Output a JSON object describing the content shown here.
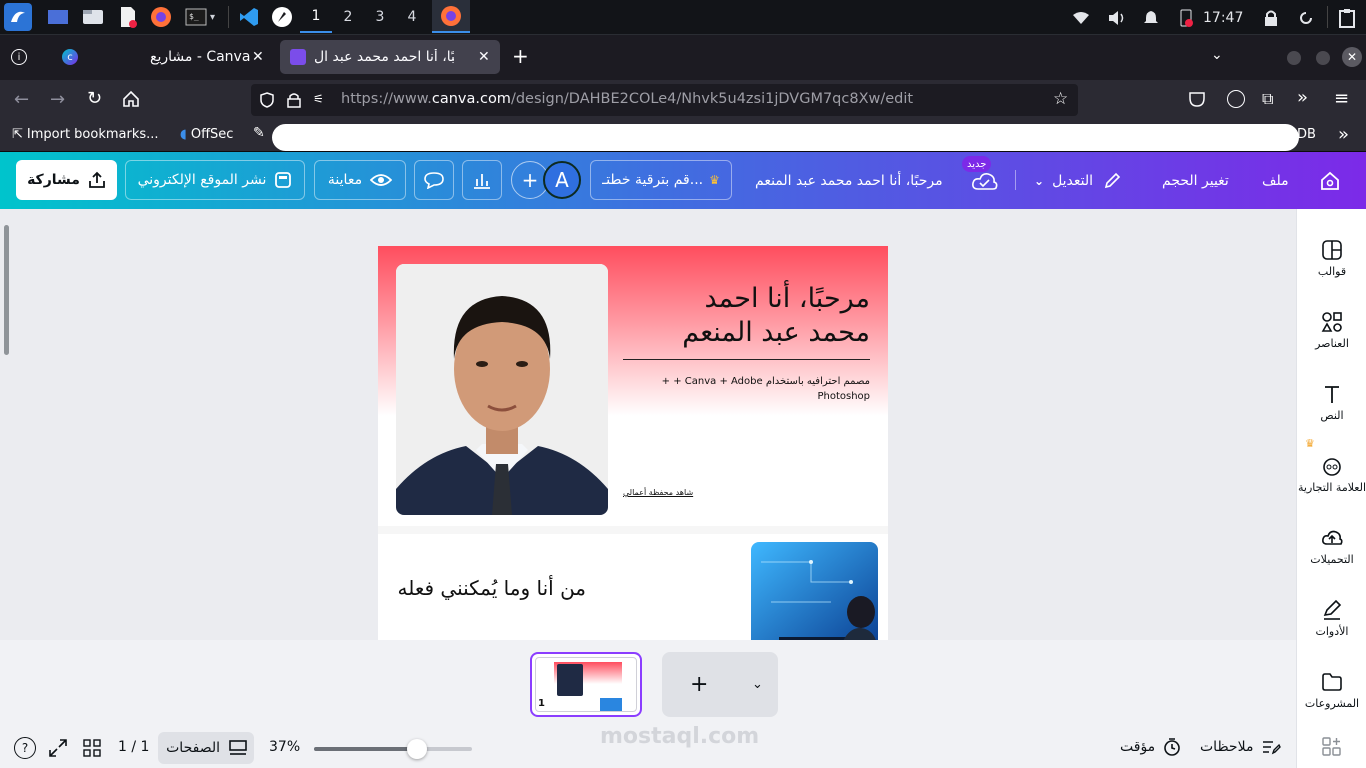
{
  "taskbar": {
    "workspaces": [
      "1",
      "2",
      "3",
      "4"
    ],
    "clock": "17:47"
  },
  "tabs": [
    {
      "label": "مشاريع - Canva"
    },
    {
      "label": "مرحبًا، أنا احمد محمد عبد ال"
    }
  ],
  "url": {
    "prefix": "https://www.",
    "domain": "canva.com",
    "path": "/design/DAHBE2COLe4/Nhvk5u4zsi1jDVGM7qc8Xw/edit"
  },
  "bookmarks": {
    "import": "Import bookmarks...",
    "offsec": "OffSec",
    "trailing": "DB"
  },
  "canva_header": {
    "file": "ملف",
    "resize": "تغيير الحجم",
    "edit": "التعديل",
    "new_badge": "جديد",
    "design_title": "مرحبًا، أنا احمد محمد عبد المنعم",
    "upgrade": "قم بترقية خطتـ...",
    "avatar_letter": "A",
    "preview": "معاينة",
    "publish": "نشر الموقع الإلكتروني",
    "share": "مشاركة"
  },
  "side_panel": [
    {
      "label": "قوالب",
      "icon": "templates-icon"
    },
    {
      "label": "العناصر",
      "icon": "elements-icon"
    },
    {
      "label": "النص",
      "icon": "text-icon"
    },
    {
      "label": "العلامة التجارية",
      "icon": "brand-icon"
    },
    {
      "label": "التحميلات",
      "icon": "uploads-icon"
    },
    {
      "label": "الأدوات",
      "icon": "tools-icon"
    },
    {
      "label": "المشروعات",
      "icon": "projects-icon"
    }
  ],
  "design": {
    "heading_line1": "مرحبًا، أنا احمد",
    "heading_line2": "محمد عبد المنعم",
    "subtitle_line1": "مصمم احترافيه باستخدام Canva + Adobe + +",
    "subtitle_line2": "Photoshop",
    "portfolio_link": "شاهد محفظة أعمالي",
    "section2_title": "من أنا وما يُمكنني فعله"
  },
  "thumbnails": {
    "page_number": "1",
    "add": "+"
  },
  "bottom_bar": {
    "notes": "ملاحظات",
    "timer": "مؤقت",
    "zoom": "37%",
    "zoom_fraction": 0.37,
    "pages": "الصفحات",
    "page_count": "1 / 1",
    "watermark": "mostaql.com"
  },
  "colors": {
    "canva_gradient_start": "#00c4cc",
    "canva_gradient_end": "#7c2ae8",
    "design_red": "#ff4d5e"
  }
}
